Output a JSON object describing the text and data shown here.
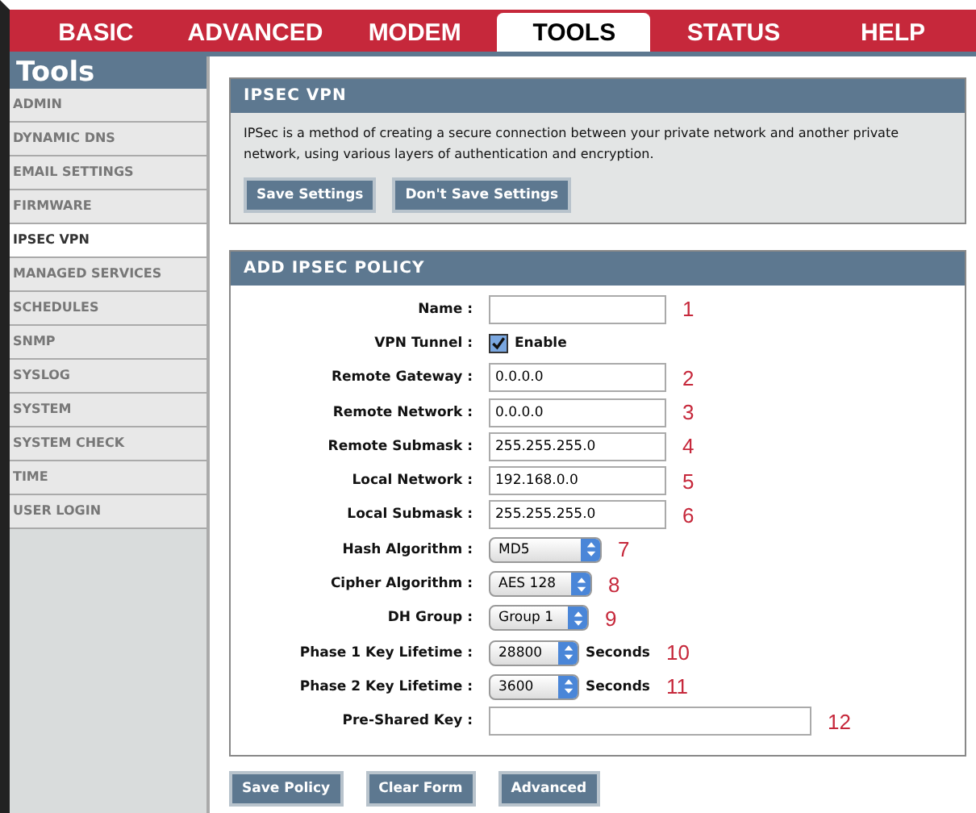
{
  "nav_tabs": [
    {
      "label": "BASIC",
      "selected": false
    },
    {
      "label": "ADVANCED",
      "selected": false
    },
    {
      "label": "MODEM",
      "selected": false
    },
    {
      "label": "TOOLS",
      "selected": true
    },
    {
      "label": "STATUS",
      "selected": false
    },
    {
      "label": "HELP",
      "selected": false
    }
  ],
  "sidebar": {
    "title": "Tools",
    "items": [
      {
        "label": "ADMIN",
        "selected": false
      },
      {
        "label": "DYNAMIC DNS",
        "selected": false
      },
      {
        "label": "EMAIL SETTINGS",
        "selected": false
      },
      {
        "label": "FIRMWARE",
        "selected": false
      },
      {
        "label": "IPSEC VPN",
        "selected": true
      },
      {
        "label": "MANAGED SERVICES",
        "selected": false
      },
      {
        "label": "SCHEDULES",
        "selected": false
      },
      {
        "label": "SNMP",
        "selected": false
      },
      {
        "label": "SYSLOG",
        "selected": false
      },
      {
        "label": "SYSTEM",
        "selected": false
      },
      {
        "label": "SYSTEM CHECK",
        "selected": false
      },
      {
        "label": "TIME",
        "selected": false
      },
      {
        "label": "USER LOGIN",
        "selected": false
      }
    ]
  },
  "intro_panel": {
    "title": "IPSEC VPN",
    "text": "IPSec is a method of creating a secure connection between your private network and another private network, using various layers of authentication and encryption.",
    "buttons": [
      "Save Settings",
      "Don't Save Settings"
    ]
  },
  "policy_panel": {
    "title": "ADD IPSEC POLICY",
    "rows": [
      {
        "kind": "text",
        "label": "Name :",
        "value": "",
        "callout": "1"
      },
      {
        "kind": "checkbox",
        "label": "VPN Tunnel :",
        "option": "Enable",
        "checked": true
      },
      {
        "kind": "text",
        "label": "Remote Gateway :",
        "value": "0.0.0.0",
        "callout": "2"
      },
      {
        "kind": "text",
        "label": "Remote Network :",
        "value": "0.0.0.0",
        "callout": "3"
      },
      {
        "kind": "text",
        "label": "Remote Submask :",
        "value": "255.255.255.0",
        "callout": "4"
      },
      {
        "kind": "text",
        "label": "Local Network :",
        "value": "192.168.0.0",
        "callout": "5"
      },
      {
        "kind": "text",
        "label": "Local Submask :",
        "value": "255.255.255.0",
        "callout": "6"
      },
      {
        "kind": "select",
        "label": "Hash Algorithm :",
        "value": "MD5",
        "callout": "7"
      },
      {
        "kind": "select",
        "label": "Cipher Algorithm :",
        "value": "AES 128",
        "callout": "8"
      },
      {
        "kind": "select",
        "label": "DH Group :",
        "value": "Group 1",
        "callout": "9"
      },
      {
        "kind": "select",
        "label": "Phase 1 Key Lifetime :",
        "value": "28800",
        "unit": "Seconds",
        "callout": "10"
      },
      {
        "kind": "select",
        "label": "Phase 2 Key Lifetime :",
        "value": "3600",
        "unit": "Seconds",
        "callout": "11"
      },
      {
        "kind": "wide_text",
        "label": "Pre-Shared Key :",
        "value": "",
        "callout": "12"
      }
    ]
  },
  "bottom_buttons": [
    "Save Policy",
    "Clear Form",
    "Advanced"
  ]
}
